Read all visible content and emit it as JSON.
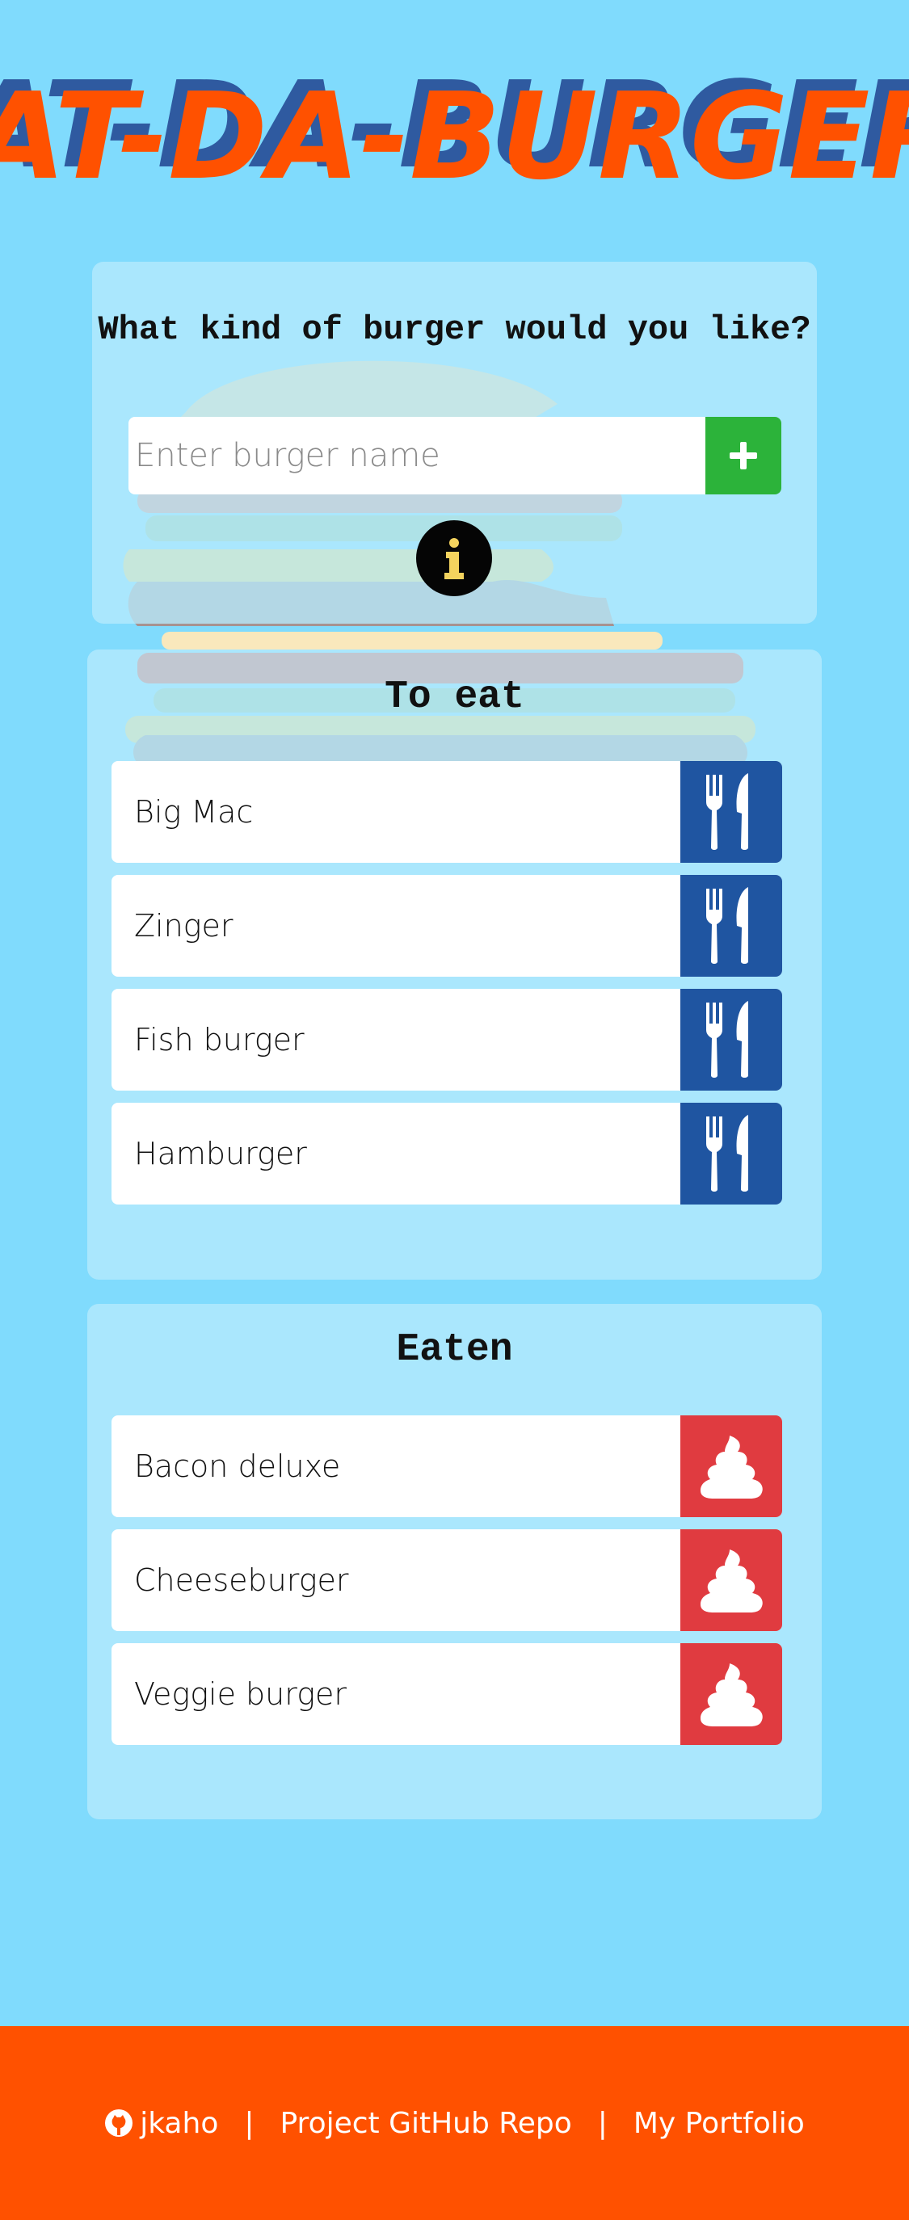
{
  "header": {
    "logo_text": "EAT-DA-BURGER!"
  },
  "form": {
    "title": "What kind of burger would you like?",
    "input_placeholder": "Enter burger name",
    "input_value": "",
    "add_icon": "plus-icon",
    "info_icon": "info-icon"
  },
  "to_eat": {
    "title": "To eat",
    "items": [
      {
        "name": "Big Mac"
      },
      {
        "name": "Zinger"
      },
      {
        "name": "Fish burger"
      },
      {
        "name": "Hamburger"
      }
    ],
    "action_icon": "utensils-icon"
  },
  "eaten": {
    "title": "Eaten",
    "items": [
      {
        "name": "Bacon deluxe"
      },
      {
        "name": "Cheeseburger"
      },
      {
        "name": "Veggie burger"
      }
    ],
    "action_icon": "poop-icon"
  },
  "footer": {
    "username": "jkaho",
    "separator": "|",
    "repo_link": "Project GitHub Repo",
    "portfolio_link": "My Portfolio"
  },
  "colors": {
    "background": "#80dbfd",
    "add_button": "#2cb33a",
    "devour_button": "#1f55a1",
    "poop_button": "#e03b40",
    "footer": "#ff5100",
    "logo": "#ff5100"
  }
}
